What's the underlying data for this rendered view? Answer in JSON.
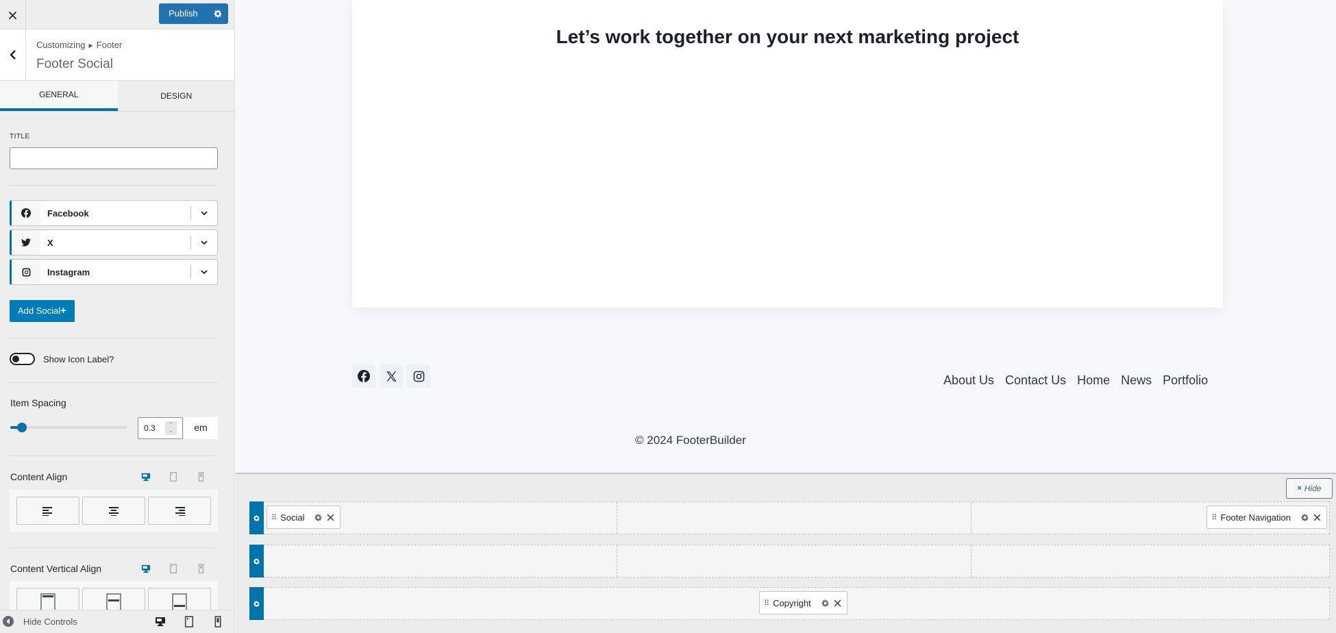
{
  "sidebar": {
    "close_label": "×",
    "publish_label": "Publish",
    "breadcrumb": {
      "root": "Customizing",
      "parent": "Footer"
    },
    "section_title": "Footer Social",
    "tabs": [
      {
        "label": "GENERAL",
        "active": true
      },
      {
        "label": "DESIGN",
        "active": false
      }
    ],
    "title_field": {
      "label": "TITLE",
      "value": ""
    },
    "social_items": [
      {
        "label": "Facebook",
        "icon": "facebook-icon"
      },
      {
        "label": "X",
        "icon": "twitter-icon"
      },
      {
        "label": "Instagram",
        "icon": "instagram-icon"
      }
    ],
    "add_social_label": "Add Social",
    "add_social_plus": "+",
    "show_icon_label": {
      "label": "Show Icon Label?",
      "checked": false
    },
    "item_spacing": {
      "label": "Item Spacing",
      "value": "0.3",
      "unit": "em",
      "slider_fraction": 0.1
    },
    "content_align": {
      "label": "Content Align",
      "options": [
        "left",
        "center",
        "right"
      ]
    },
    "content_vertical_align": {
      "label": "Content Vertical Align",
      "options": [
        "top",
        "middle",
        "bottom"
      ]
    },
    "hide_controls_label": "Hide Controls"
  },
  "preview": {
    "heading": "Let’s work together on your next marketing project",
    "social_icons": [
      "facebook",
      "x",
      "instagram"
    ],
    "nav_links": [
      "About Us",
      "Contact Us",
      "Home",
      "News",
      "Portfolio"
    ],
    "copyright": "© 2024 FooterBuilder"
  },
  "builder": {
    "hide_label": "Hide",
    "rows": [
      {
        "cols": [
          {
            "chips": [
              "Social"
            ]
          },
          {
            "chips": []
          },
          {
            "chips": [
              "Footer Navigation"
            ]
          }
        ]
      },
      {
        "cols": [
          {
            "chips": []
          },
          {
            "chips": []
          },
          {
            "chips": []
          }
        ]
      },
      {
        "cols": [
          {
            "chips": [
              "Copyright"
            ]
          }
        ]
      }
    ]
  },
  "colors": {
    "accent": "#0073aa",
    "publish": "#2271b1",
    "preview_bg": "#f6f8fb",
    "builder_bg": "#ececec"
  }
}
